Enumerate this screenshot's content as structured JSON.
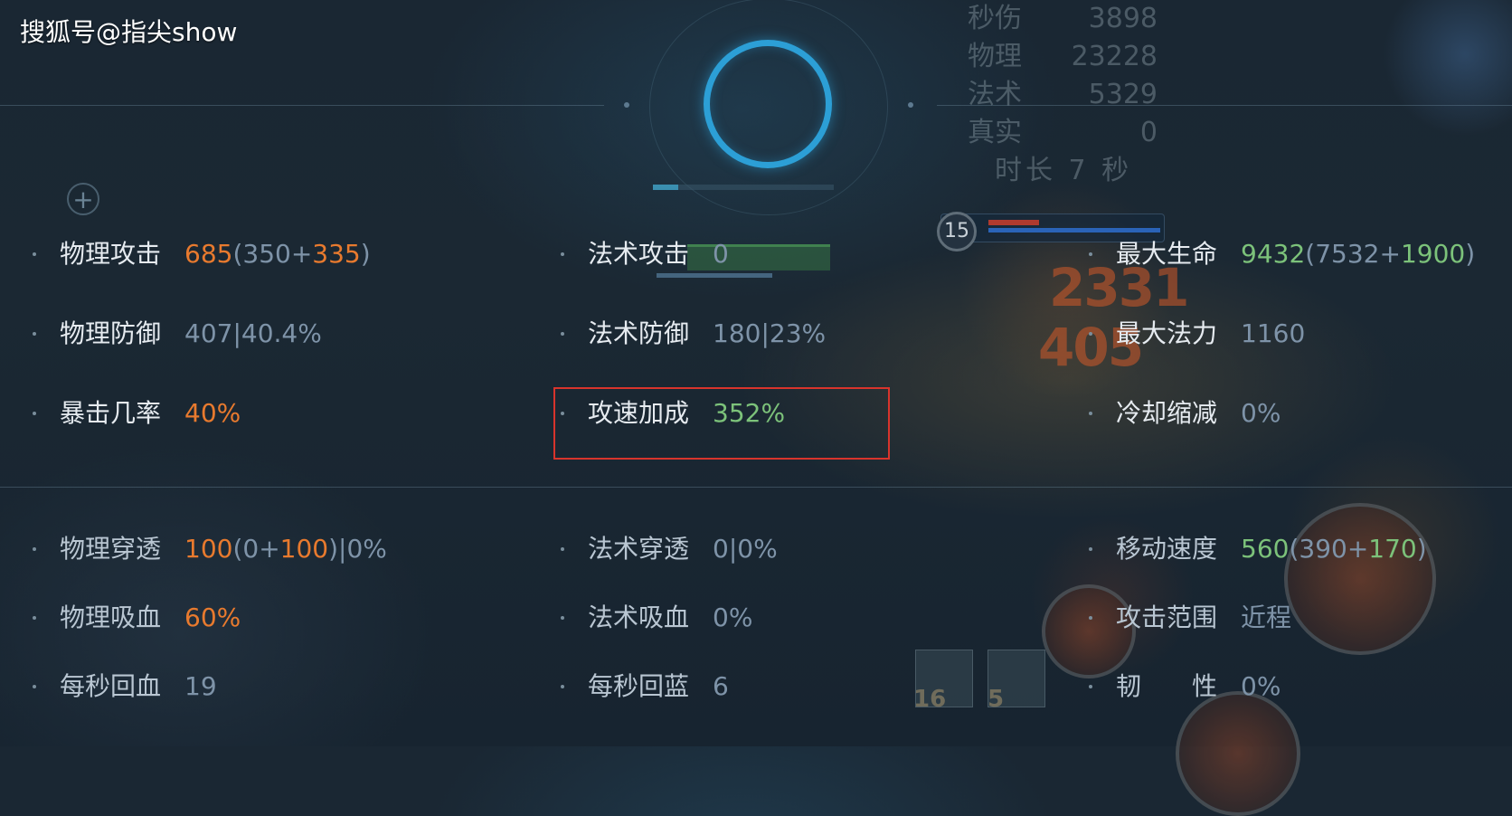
{
  "watermark": "搜狐号@指尖show",
  "damage_panel": {
    "rows": [
      {
        "label": "秒伤",
        "value": "3898"
      },
      {
        "label": "物理",
        "value": "23228"
      },
      {
        "label": "法术",
        "value": "5329"
      },
      {
        "label": "真实",
        "value": "0"
      }
    ],
    "duration": "时长 7 秒"
  },
  "hero": {
    "level": "15"
  },
  "float_numbers": [
    "2331",
    "405"
  ],
  "bottom_icon_counts": [
    "16",
    "5"
  ],
  "stats_upper": {
    "col1": [
      {
        "label": "物理攻击",
        "value_parts": [
          {
            "text": "685",
            "color": "orange"
          },
          {
            "text": "(350+",
            "color": "grey"
          },
          {
            "text": "335",
            "color": "orange"
          },
          {
            "text": ")",
            "color": "grey"
          }
        ]
      },
      {
        "label": "物理防御",
        "value_parts": [
          {
            "text": "407|40.4%",
            "color": "grey"
          }
        ]
      },
      {
        "label": "暴击几率",
        "value_parts": [
          {
            "text": "40%",
            "color": "orange"
          }
        ]
      }
    ],
    "col2": [
      {
        "label": "法术攻击",
        "value_parts": [
          {
            "text": "0",
            "color": "grey"
          }
        ]
      },
      {
        "label": "法术防御",
        "value_parts": [
          {
            "text": "180|23%",
            "color": "grey"
          }
        ]
      },
      {
        "label": "攻速加成",
        "value_parts": [
          {
            "text": "352%",
            "color": "green"
          }
        ]
      }
    ],
    "col3": [
      {
        "label": "最大生命",
        "value_parts": [
          {
            "text": "9432",
            "color": "green"
          },
          {
            "text": "(7532+",
            "color": "grey"
          },
          {
            "text": "1900",
            "color": "green"
          },
          {
            "text": ")",
            "color": "grey"
          }
        ]
      },
      {
        "label": "最大法力",
        "value_parts": [
          {
            "text": "1160",
            "color": "grey"
          }
        ]
      },
      {
        "label": "冷却缩减",
        "value_parts": [
          {
            "text": "0%",
            "color": "grey"
          }
        ]
      }
    ]
  },
  "stats_lower": {
    "col1": [
      {
        "label": "物理穿透",
        "value_parts": [
          {
            "text": "100",
            "color": "orange"
          },
          {
            "text": "(0+",
            "color": "grey"
          },
          {
            "text": "100",
            "color": "orange"
          },
          {
            "text": ")|0%",
            "color": "grey"
          }
        ]
      },
      {
        "label": "物理吸血",
        "value_parts": [
          {
            "text": "60%",
            "color": "orange"
          }
        ]
      },
      {
        "label": "每秒回血",
        "value_parts": [
          {
            "text": "19",
            "color": "grey"
          }
        ]
      }
    ],
    "col2": [
      {
        "label": "法术穿透",
        "value_parts": [
          {
            "text": "0|0%",
            "color": "grey"
          }
        ]
      },
      {
        "label": "法术吸血",
        "value_parts": [
          {
            "text": "0%",
            "color": "grey"
          }
        ]
      },
      {
        "label": "每秒回蓝",
        "value_parts": [
          {
            "text": "6",
            "color": "grey"
          }
        ]
      }
    ],
    "col3": [
      {
        "label": "移动速度",
        "value_parts": [
          {
            "text": "560",
            "color": "green"
          },
          {
            "text": "(390+",
            "color": "grey"
          },
          {
            "text": "170",
            "color": "green"
          },
          {
            "text": ")",
            "color": "grey"
          }
        ]
      },
      {
        "label": "攻击范围",
        "value_parts": [
          {
            "text": "近程",
            "color": "grey"
          }
        ]
      },
      {
        "label": "韧　　性",
        "value_parts": [
          {
            "text": "0%",
            "color": "grey"
          }
        ]
      }
    ]
  },
  "colors": {
    "orange": "#e87a2e",
    "green": "#7cc27a",
    "grey": "#7e93a8",
    "highlight": "#d8342c"
  }
}
